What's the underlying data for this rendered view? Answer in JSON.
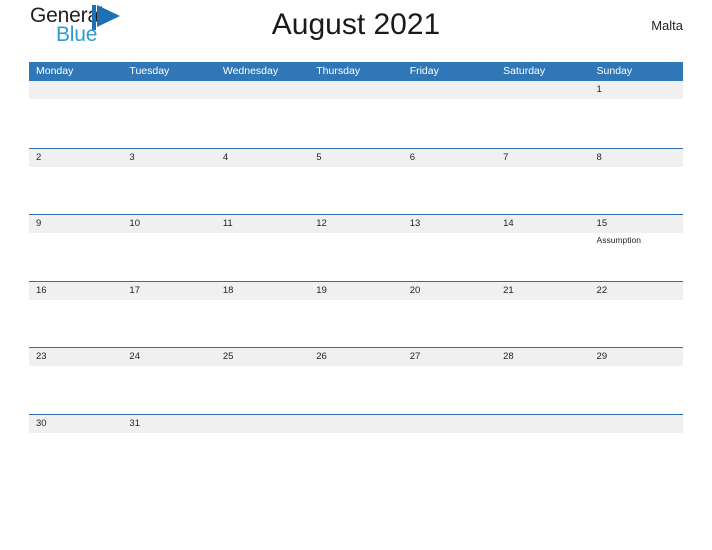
{
  "brand": {
    "name_part1": "General",
    "name_part2": "Blue",
    "flag_icon": "flag-triangle-icon",
    "color_dark": "#231f20",
    "color_blue": "#2e9bd8",
    "color_flag": "#1f6fb5"
  },
  "header": {
    "title": "August 2021",
    "region": "Malta"
  },
  "calendar": {
    "accent_color": "#3077b8",
    "band_color": "#f0f0f0",
    "rule_color": "#2f6fae",
    "weekdays": [
      "Monday",
      "Tuesday",
      "Wednesday",
      "Thursday",
      "Friday",
      "Saturday",
      "Sunday"
    ],
    "weeks": [
      [
        {
          "day": "",
          "event": ""
        },
        {
          "day": "",
          "event": ""
        },
        {
          "day": "",
          "event": ""
        },
        {
          "day": "",
          "event": ""
        },
        {
          "day": "",
          "event": ""
        },
        {
          "day": "",
          "event": ""
        },
        {
          "day": "1",
          "event": ""
        }
      ],
      [
        {
          "day": "2",
          "event": ""
        },
        {
          "day": "3",
          "event": ""
        },
        {
          "day": "4",
          "event": ""
        },
        {
          "day": "5",
          "event": ""
        },
        {
          "day": "6",
          "event": ""
        },
        {
          "day": "7",
          "event": ""
        },
        {
          "day": "8",
          "event": ""
        }
      ],
      [
        {
          "day": "9",
          "event": ""
        },
        {
          "day": "10",
          "event": ""
        },
        {
          "day": "11",
          "event": ""
        },
        {
          "day": "12",
          "event": ""
        },
        {
          "day": "13",
          "event": ""
        },
        {
          "day": "14",
          "event": ""
        },
        {
          "day": "15",
          "event": "Assumption"
        }
      ],
      [
        {
          "day": "16",
          "event": ""
        },
        {
          "day": "17",
          "event": ""
        },
        {
          "day": "18",
          "event": ""
        },
        {
          "day": "19",
          "event": ""
        },
        {
          "day": "20",
          "event": ""
        },
        {
          "day": "21",
          "event": ""
        },
        {
          "day": "22",
          "event": ""
        }
      ],
      [
        {
          "day": "23",
          "event": ""
        },
        {
          "day": "24",
          "event": ""
        },
        {
          "day": "25",
          "event": ""
        },
        {
          "day": "26",
          "event": ""
        },
        {
          "day": "27",
          "event": ""
        },
        {
          "day": "28",
          "event": ""
        },
        {
          "day": "29",
          "event": ""
        }
      ],
      [
        {
          "day": "30",
          "event": ""
        },
        {
          "day": "31",
          "event": ""
        },
        {
          "day": "",
          "event": ""
        },
        {
          "day": "",
          "event": ""
        },
        {
          "day": "",
          "event": ""
        },
        {
          "day": "",
          "event": ""
        },
        {
          "day": "",
          "event": ""
        }
      ]
    ]
  }
}
